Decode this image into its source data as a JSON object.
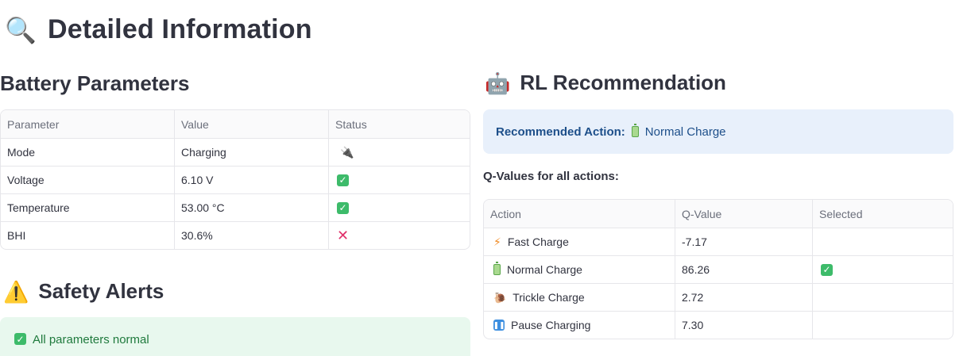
{
  "page": {
    "title": "Detailed Information",
    "title_icon": "magnifying-glass-icon"
  },
  "battery_parameters": {
    "title": "Battery Parameters",
    "columns": [
      "Parameter",
      "Value",
      "Status"
    ],
    "rows": [
      {
        "parameter": "Mode",
        "value": "Charging",
        "status_icon": "plug-icon"
      },
      {
        "parameter": "Voltage",
        "value": "6.10 V",
        "status_icon": "check-icon"
      },
      {
        "parameter": "Temperature",
        "value": "53.00 °C",
        "status_icon": "check-icon"
      },
      {
        "parameter": "BHI",
        "value": "30.6%",
        "status_icon": "cross-icon"
      }
    ]
  },
  "safety_alerts": {
    "title": "Safety Alerts",
    "title_icon": "warning-icon",
    "message": "All parameters normal",
    "message_icon": "check-icon"
  },
  "rl_recommendation": {
    "title": "RL Recommendation",
    "title_icon": "robot-icon",
    "recommended_label": "Recommended Action:",
    "recommended_action": "Normal Charge",
    "recommended_icon": "battery-icon",
    "qvalues_label": "Q-Values for all actions:",
    "columns": [
      "Action",
      "Q-Value",
      "Selected"
    ],
    "rows": [
      {
        "action": "Fast Charge",
        "icon": "lightning-icon",
        "q_value": "-7.17",
        "selected": false
      },
      {
        "action": "Normal Charge",
        "icon": "battery-icon",
        "q_value": "86.26",
        "selected": true
      },
      {
        "action": "Trickle Charge",
        "icon": "snail-icon",
        "q_value": "2.72",
        "selected": false
      },
      {
        "action": "Pause Charging",
        "icon": "pause-icon",
        "q_value": "7.30",
        "selected": false
      }
    ]
  },
  "colors": {
    "info_bg": "#e8f0fb",
    "success_bg": "#e8f8ee",
    "check_green": "#3dbb6a",
    "cross_red": "#e0306a"
  }
}
